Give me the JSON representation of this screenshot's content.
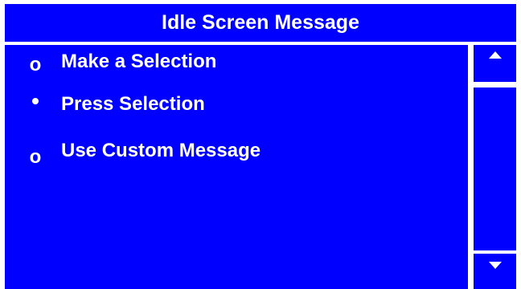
{
  "header": {
    "title": "Idle Screen Message"
  },
  "options": [
    {
      "marker": "o",
      "label": "Make a Selection",
      "selected": false
    },
    {
      "marker": "•",
      "label": "Press Selection",
      "selected": true
    },
    {
      "marker": "o",
      "label": "Use Custom Message",
      "selected": false
    }
  ],
  "colors": {
    "background": "#0000ff",
    "text": "#ffffff",
    "divider": "#ffffff"
  },
  "scroll": {
    "up_icon": "arrow-up-icon",
    "down_icon": "arrow-down-icon"
  }
}
